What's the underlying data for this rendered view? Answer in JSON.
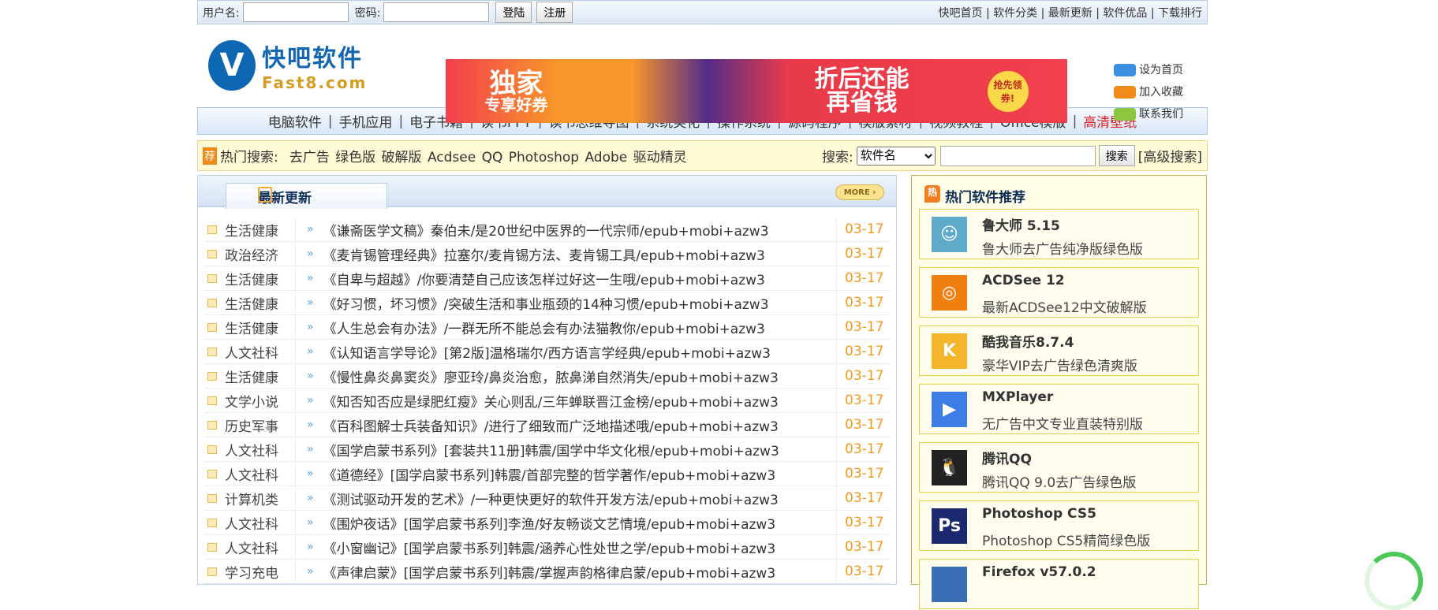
{
  "topbar": {
    "username_label": "用户名:",
    "password_label": "密码:",
    "login": "登陆",
    "register": "注册",
    "links": [
      "快吧首页",
      "软件分类",
      "最新更新",
      "软件优品",
      "下载排行"
    ]
  },
  "logo": {
    "cn": "快吧软件",
    "en": "Fast8.com"
  },
  "banner": {
    "left_big": "独家",
    "left_small": "专享好券",
    "right_top": "折后还能",
    "right_bottom": "再省钱",
    "badge": "抢先领券!"
  },
  "side_links": [
    {
      "label": "设为首页",
      "color": "#3b8fe0"
    },
    {
      "label": "加入收藏",
      "color": "#f08a19"
    },
    {
      "label": "联系我们",
      "color": "#8cc63e"
    }
  ],
  "nav": {
    "items": [
      "电脑软件",
      "手机应用",
      "电子书籍",
      "读书PPT",
      "读书思维导图",
      "系统美化",
      "操作系统",
      "源码程序",
      "模版素材",
      "视频教程",
      "Office模版"
    ],
    "highlight": "高清壁纸"
  },
  "hot": {
    "badge": "荐",
    "label": "热门搜索:",
    "keywords": "去广告 绿色版 破解版 Acdsee QQ Photoshop Adobe 驱动精灵",
    "search_label": "搜索:",
    "select_value": "软件名",
    "search_button": "搜索",
    "advanced": "[高级搜索]"
  },
  "latest": {
    "title": "最新更新",
    "more": "MORE",
    "rows": [
      {
        "cat": "生活健康",
        "title": "《谦斋医学文稿》秦伯未/是20世纪中医界的一代宗师/epub+mobi+azw3",
        "date": "03-17"
      },
      {
        "cat": "政治经济",
        "title": "《麦肯锡管理经典》拉塞尔/麦肯锡方法、麦肯锡工具/epub+mobi+azw3",
        "date": "03-17"
      },
      {
        "cat": "生活健康",
        "title": "《自卑与超越》/你要清楚自己应该怎样过好这一生哦/epub+mobi+azw3",
        "date": "03-17"
      },
      {
        "cat": "生活健康",
        "title": "《好习惯，坏习惯》/突破生活和事业瓶颈的14种习惯/epub+mobi+azw3",
        "date": "03-17"
      },
      {
        "cat": "生活健康",
        "title": "《人生总会有办法》/一群无所不能总会有办法猫教你/epub+mobi+azw3",
        "date": "03-17"
      },
      {
        "cat": "人文社科",
        "title": "《认知语言学导论》[第2版]温格瑞尔/西方语言学经典/epub+mobi+azw3",
        "date": "03-17"
      },
      {
        "cat": "生活健康",
        "title": "《慢性鼻炎鼻窦炎》廖亚玲/鼻炎治愈，脓鼻涕自然消失/epub+mobi+azw3",
        "date": "03-17"
      },
      {
        "cat": "文学小说",
        "title": "《知否知否应是绿肥红瘦》关心则乱/三年蝉联晋江金榜/epub+mobi+azw3",
        "date": "03-17"
      },
      {
        "cat": "历史军事",
        "title": "《百科图解士兵装备知识》/进行了细致而广泛地描述哦/epub+mobi+azw3",
        "date": "03-17"
      },
      {
        "cat": "人文社科",
        "title": "《国学启蒙书系列》[套装共11册]韩震/国学中华文化根/epub+mobi+azw3",
        "date": "03-17"
      },
      {
        "cat": "人文社科",
        "title": "《道德经》[国学启蒙书系列]韩震/首部完整的哲学著作/epub+mobi+azw3",
        "date": "03-17"
      },
      {
        "cat": "计算机类",
        "title": "《测试驱动开发的艺术》/一种更快更好的软件开发方法/epub+mobi+azw3",
        "date": "03-17"
      },
      {
        "cat": "人文社科",
        "title": "《围炉夜话》[国学启蒙书系列]李渔/好友畅谈文艺情境/epub+mobi+azw3",
        "date": "03-17"
      },
      {
        "cat": "人文社科",
        "title": "《小窗幽记》[国学启蒙书系列]韩震/涵养心性处世之学/epub+mobi+azw3",
        "date": "03-17"
      },
      {
        "cat": "学习充电",
        "title": "《声律启蒙》[国学启蒙书系列]韩震/掌握声韵格律启蒙/epub+mobi+azw3",
        "date": "03-17"
      }
    ]
  },
  "hot_software": {
    "badge": "热",
    "title": "热门软件推荐",
    "items": [
      {
        "name": "鲁大师 5.15",
        "desc": "鲁大师去广告纯净版绿色版",
        "icon": "ludashi-icon",
        "color": "#5fa9c9",
        "glyph": "☺"
      },
      {
        "name": "ACDSee 12",
        "desc": "最新ACDSee12中文破解版",
        "icon": "acdsee-icon",
        "color": "#f07f10",
        "glyph": "◎"
      },
      {
        "name": "酷我音乐8.7.4",
        "desc": "豪华VIP去广告绿色清爽版",
        "icon": "kuwo-icon",
        "color": "#f5b52a",
        "glyph": "K"
      },
      {
        "name": "MXPlayer",
        "desc": "无广告中文专业直装特别版",
        "icon": "mxplayer-icon",
        "color": "#3d7ee6",
        "glyph": "▶"
      },
      {
        "name": "腾讯QQ",
        "desc": "腾讯QQ 9.0去广告绿色版",
        "icon": "qq-icon",
        "color": "#222222",
        "glyph": "🐧"
      },
      {
        "name": "Photoshop CS5",
        "desc": "Photoshop CS5精简绿色版",
        "icon": "photoshop-icon",
        "color": "#1b2a6e",
        "glyph": "Ps"
      },
      {
        "name": "Firefox v57.0.2",
        "desc": "",
        "icon": "firefox-icon",
        "color": "#3a6fb5",
        "glyph": ""
      }
    ]
  }
}
